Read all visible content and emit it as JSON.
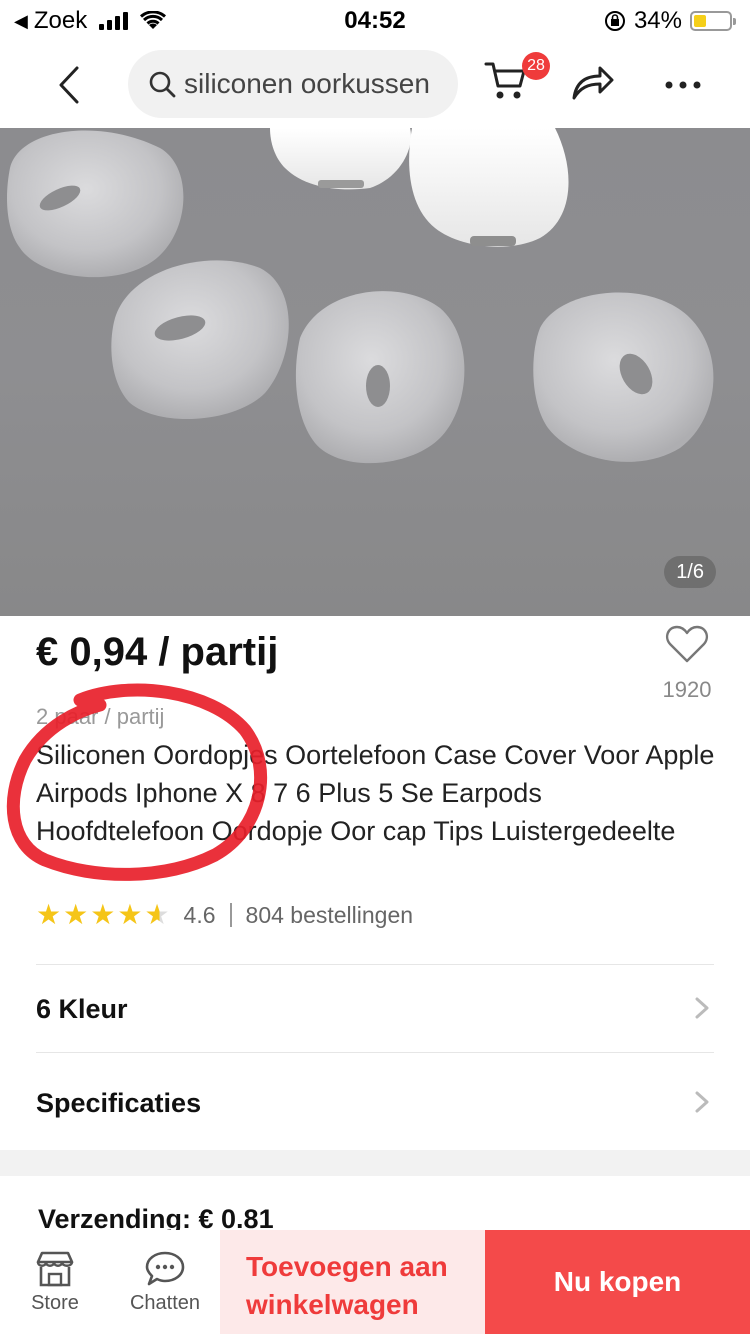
{
  "status_bar": {
    "back_app": "Zoek",
    "time": "04:52",
    "battery": "34%",
    "battery_level": 0.34
  },
  "nav": {
    "search_text": "siliconen oorkussen",
    "cart_count": "28"
  },
  "gallery": {
    "counter": "1/6"
  },
  "product": {
    "price": "€ 0,94 / partij",
    "wishlist_count": "1920",
    "unit_note": "2 paar / partij",
    "title": "Siliconen Oordopjes Oortelefoon Case Cover Voor Apple Airpods Iphone X 8 7 6 Plus 5 Se Earpods Hoofdtelefoon Oordopje Oor cap Tips Luistergedeelte",
    "rating": "4.6",
    "rating_value": 4.6,
    "orders": "804 bestellingen"
  },
  "rows": {
    "colors": "6 Kleur",
    "specs": "Specificaties"
  },
  "shipping": "Verzending: € 0.81",
  "bottom_bar": {
    "store": "Store",
    "chat": "Chatten",
    "add_to_cart_line1": "Toevoegen aan",
    "add_to_cart_line2": "winkelwagen",
    "buy_now": "Nu kopen"
  },
  "colors": {
    "accent_red": "#ef3b3b",
    "star_yellow": "#f5c518",
    "annotation_red": "#e8202a"
  },
  "icons": [
    "back-arrow-icon",
    "search-icon",
    "cart-icon",
    "share-icon",
    "more-icon",
    "heart-icon",
    "star-icon",
    "chevron-right-icon",
    "store-icon",
    "chat-icon"
  ]
}
